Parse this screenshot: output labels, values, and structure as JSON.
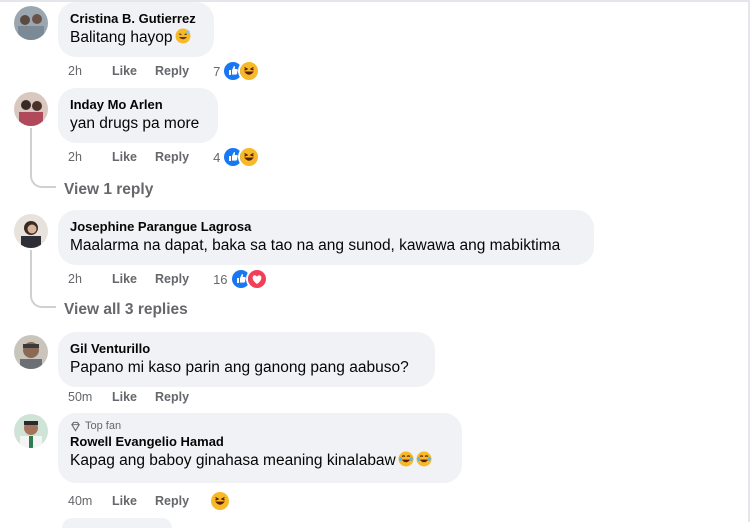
{
  "comments": [
    {
      "name": "Cristina B. Gutierrez",
      "text": "Balitang hayop",
      "text_emoji": "grin-sweat-emoji",
      "time": "2h",
      "like": "Like",
      "reply": "Reply",
      "reaction_count": "7",
      "reactions": [
        "like",
        "haha"
      ]
    },
    {
      "name": "Inday Mo Arlen",
      "text": "yan drugs pa more",
      "time": "2h",
      "like": "Like",
      "reply": "Reply",
      "reaction_count": "4",
      "reactions": [
        "like",
        "haha"
      ],
      "view_replies": "View 1 reply"
    },
    {
      "name": "Josephine Parangue Lagrosa",
      "text": "Maalarma na dapat, baka sa tao na ang sunod, kawawa ang mabiktima",
      "time": "2h",
      "like": "Like",
      "reply": "Reply",
      "reaction_count": "16",
      "reactions": [
        "like",
        "love"
      ],
      "view_replies": "View all 3 replies"
    },
    {
      "name": "Gil Venturillo",
      "text": "Papano mi kaso parin ang ganong pang aabuso?",
      "time": "50m",
      "like": "Like",
      "reply": "Reply"
    },
    {
      "badge": "Top fan",
      "badge_icon": "diamond-icon",
      "name": "Rowell Evangelio Hamad",
      "text": "Kapag ang baboy ginahasa meaning kinalabaw",
      "text_emoji": "joy-emoji",
      "time": "40m",
      "like": "Like",
      "reply": "Reply",
      "reaction_emoji": "haha"
    }
  ],
  "colors": {
    "bubble": "#f0f2f5",
    "secondary_text": "#65676b",
    "like_blue": "#1877f2",
    "love_red": "#f33e58",
    "haha_yellow": "#f7b928"
  }
}
